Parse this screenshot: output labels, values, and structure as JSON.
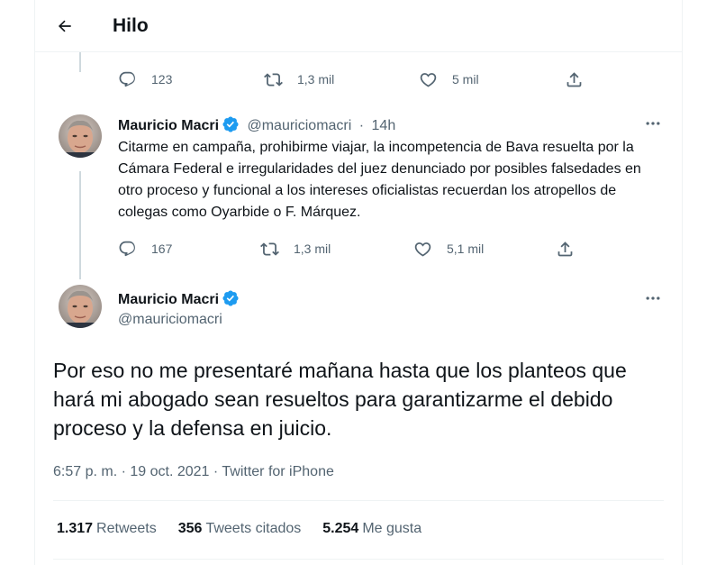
{
  "header": {
    "title": "Hilo"
  },
  "prev_tweet_actions": {
    "replies": "123",
    "retweets": "1,3 mil",
    "likes": "5 mil"
  },
  "tweet1": {
    "name": "Mauricio Macri",
    "handle": "@mauriciomacri",
    "sep": "·",
    "time": "14h",
    "text": "Citarme en campaña, prohibirme viajar, la incompetencia de Bava resuelta por la Cámara Federal e irregularidades del juez denunciado por posibles falsedades en otro proceso y funcional a los intereses oficialistas recuerdan los atropellos de colegas como Oyarbide o F. Márquez.",
    "replies": "167",
    "retweets": "1,3 mil",
    "likes": "5,1 mil"
  },
  "tweet2": {
    "name": "Mauricio Macri",
    "handle": "@mauriciomacri",
    "text": "Por eso no me presentaré mañana hasta que los planteos que hará mi abogado sean resueltos para garantizarme el debido proceso y la defensa en juicio.",
    "timestamp": "6:57 p. m. · 19 oct. 2021 · ",
    "source": "Twitter for iPhone"
  },
  "stats": {
    "retweets_count": "1.317",
    "retweets_label": "Retweets",
    "quotes_count": "356",
    "quotes_label": "Tweets citados",
    "likes_count": "5.254",
    "likes_label": "Me gusta"
  },
  "colors": {
    "verified": "#1d9bf0",
    "muted": "#536471",
    "border": "#eff3f4",
    "thread": "#cfd9de"
  }
}
